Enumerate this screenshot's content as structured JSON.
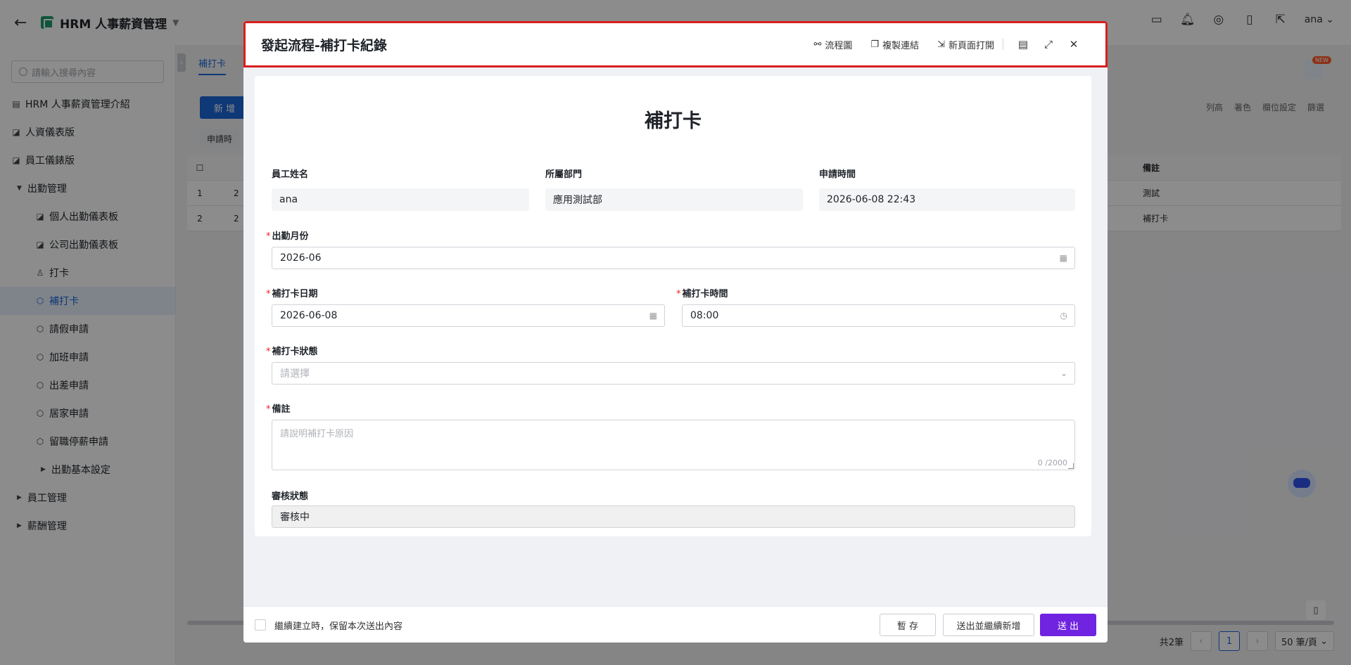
{
  "app": {
    "title": "HRM 人事薪資管理",
    "user": "ana"
  },
  "sidebar": {
    "search_placeholder": "請輸入搜尋內容",
    "items": [
      {
        "label": "HRM 人事薪資管理介紹",
        "icon": "table-icon"
      },
      {
        "label": "人資儀表版",
        "icon": "dashboard-icon"
      },
      {
        "label": "員工儀錶版",
        "icon": "dashboard-icon"
      },
      {
        "label": "出勤管理",
        "icon": "caret-down-icon"
      },
      {
        "label": "個人出勤儀表板",
        "icon": "dashboard-icon"
      },
      {
        "label": "公司出勤儀表板",
        "icon": "dashboard-icon"
      },
      {
        "label": "打卡",
        "icon": "user-icon"
      },
      {
        "label": "補打卡",
        "icon": "cube-icon"
      },
      {
        "label": "請假申請",
        "icon": "cube-icon"
      },
      {
        "label": "加班申請",
        "icon": "cube-icon"
      },
      {
        "label": "出差申請",
        "icon": "cube-icon"
      },
      {
        "label": "居家申請",
        "icon": "cube-icon"
      },
      {
        "label": "留職停薪申請",
        "icon": "cube-icon"
      },
      {
        "label": "出勤基本設定",
        "icon": "caret-right-icon"
      },
      {
        "label": "員工管理",
        "icon": "caret-right-icon"
      },
      {
        "label": "薪酬管理",
        "icon": "caret-right-icon"
      }
    ]
  },
  "content": {
    "tab": "補打卡",
    "add_button": "新 增",
    "filter_chip": "申請時",
    "tools": [
      "列高",
      "著色",
      "欄位設定",
      "篩選"
    ],
    "new_badge": "NEW",
    "table_header_note": "備註",
    "rows": [
      {
        "index": "1",
        "partial": "2",
        "note": "測試"
      },
      {
        "index": "2",
        "partial": "2",
        "note": "補打卡"
      }
    ],
    "pager": {
      "total": "共2筆",
      "page": "1",
      "size": "50 筆/頁"
    }
  },
  "modal": {
    "title": "發起流程-補打卡紀錄",
    "actions": {
      "flowchart": "流程圖",
      "copy_link": "複製連結",
      "open_new": "新頁面打開"
    },
    "form": {
      "title": "補打卡",
      "employee_name_label": "員工姓名",
      "employee_name": "ana",
      "department_label": "所屬部門",
      "department": "應用測試部",
      "apply_time_label": "申請時間",
      "apply_time": "2026-06-08 22:43",
      "month_label": "出勤月份",
      "month": "2026-06",
      "date_label": "補打卡日期",
      "date": "2026-06-08",
      "time_label": "補打卡時間",
      "time": "08:00",
      "status_label": "補打卡狀態",
      "status_placeholder": "請選擇",
      "note_label": "備註",
      "note_placeholder": "請說明補打卡原因",
      "note_counter": "0 /2000",
      "review_label": "審核狀態",
      "review_value": "審核中",
      "required_mark": "*"
    },
    "footer": {
      "keep_label": "繼續建立時，保留本次送出內容",
      "save": "暫 存",
      "submit_continue": "送出並繼續新增",
      "submit": "送 出"
    }
  },
  "colors": {
    "primary": "#7023e0",
    "highlight_outline": "#d81e1e",
    "active_blue": "#1a67d8"
  }
}
